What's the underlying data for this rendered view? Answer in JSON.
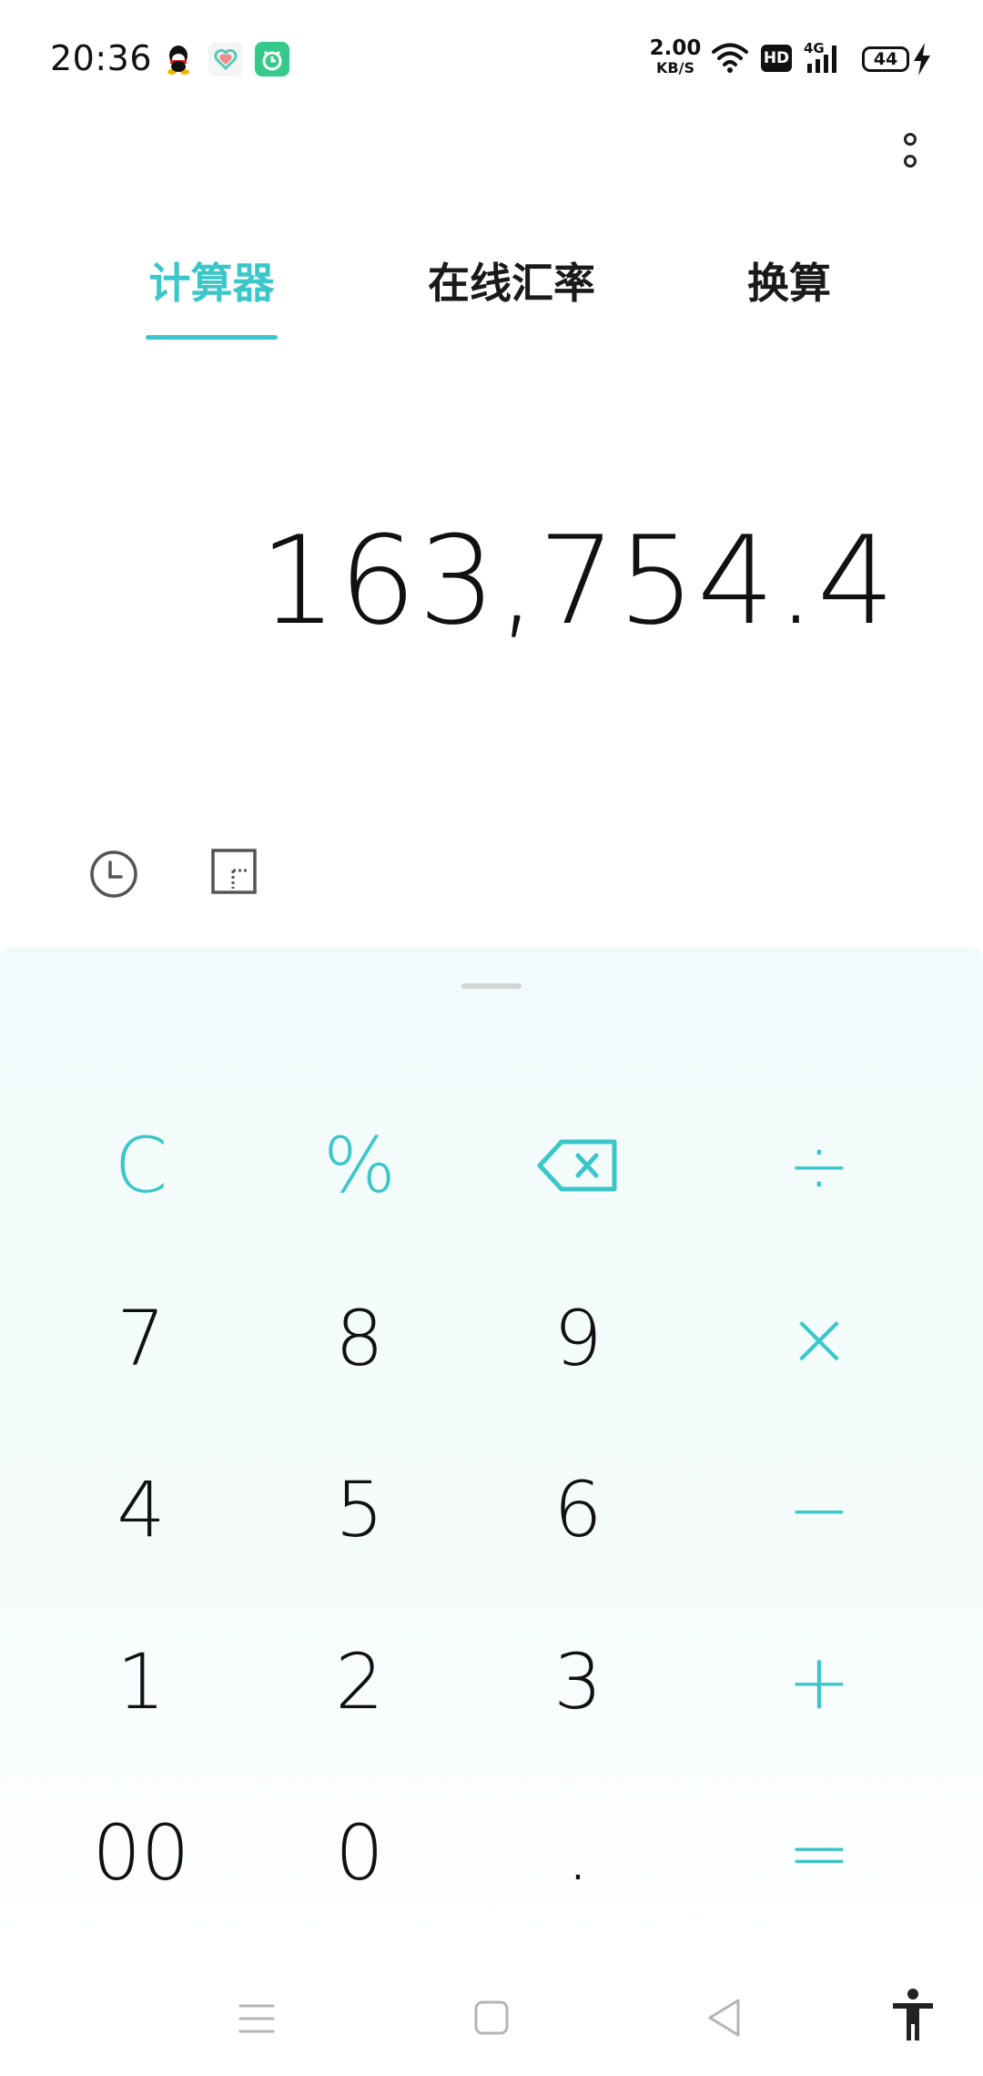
{
  "status_bar": {
    "time": "20:36",
    "net_speed_value": "2.00",
    "net_speed_unit": "KB/S",
    "hd_label": "HD",
    "signal_label": "4G",
    "battery_level": "44",
    "apps": [
      "qq-icon",
      "health-icon",
      "alarm-app-icon"
    ],
    "icons": [
      "wifi-icon",
      "hd-icon",
      "signal-4g-icon",
      "battery-icon",
      "charging-icon"
    ]
  },
  "tabs": [
    {
      "label": "计算器",
      "active": true
    },
    {
      "label": "在线汇率",
      "active": false
    },
    {
      "label": "换算",
      "active": false
    }
  ],
  "display": {
    "value": "163,754.4"
  },
  "keypad": {
    "rows": [
      [
        {
          "label": "C"
        },
        {
          "label": "%"
        },
        {
          "icon": "backspace-icon"
        },
        {
          "label": "÷"
        }
      ],
      [
        {
          "label": "7"
        },
        {
          "label": "8"
        },
        {
          "label": "9"
        },
        {
          "label": "×"
        }
      ],
      [
        {
          "label": "4"
        },
        {
          "label": "5"
        },
        {
          "label": "6"
        },
        {
          "label": "−"
        }
      ],
      [
        {
          "label": "1"
        },
        {
          "label": "2"
        },
        {
          "label": "3"
        },
        {
          "label": "+"
        }
      ],
      [
        {
          "label": "00"
        },
        {
          "label": "0"
        },
        {
          "label": "."
        },
        {
          "label": "="
        }
      ]
    ]
  },
  "colors": {
    "accent": "#3bc7c9",
    "text": "#111111",
    "keypad_bg": "#f2fbfb"
  },
  "navigation_bar": {
    "icons": [
      "menu-icon",
      "home-icon",
      "back-icon",
      "accessibility-icon"
    ]
  }
}
